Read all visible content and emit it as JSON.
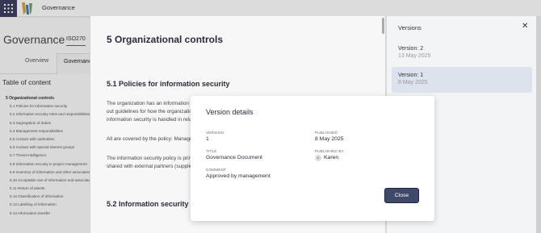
{
  "topbar": {
    "title": "Governance"
  },
  "background": {
    "page_title": "Governance",
    "doc_id": "ISO270",
    "tabs": [
      "Overview",
      "Governance"
    ],
    "toc_title": "Table of content",
    "toc": [
      "5 Organizational controls",
      "5.1 Policies for information security",
      "5.2 Information security roles and responsibilities",
      "5.3 Segregation of duties",
      "5.4 Management responsibilities",
      "5.5 Contact with authorities",
      "5.6 Contact with special interest groups",
      "5.7 Threat intelligence",
      "5.8 Information security in project management",
      "5.9 Inventory of information and other associated",
      "5.10 Acceptable use of information and associated",
      "5.11 Return of assets",
      "5.12 Classification of information",
      "5.13 Labelling of information",
      "5.14 Information transfer"
    ]
  },
  "document": {
    "h1": "5 Organizational controls",
    "h2_1": "5.1 Policies for information security",
    "p1": "The organization has an information security policy which describes the principles for information security work and set out guidelines for how the organization complies with legal requirements (including GDPR) and regulations and how information security is handled in relation to other policy requirements.",
    "p2": "All are covered by the policy: Management, employees, consultants, contractors and temporary staff.",
    "p3": "The information security policy is primarily aimed at internal use, but also covers External Relations, but can also be shared with external partners (suppliers, partners, consultants, etc.), where the collaboration is so extensive.",
    "h2_2": "5.2 Information security roles and responsibilities"
  },
  "versions": {
    "title": "Versions",
    "close_icon": "close-icon",
    "items": [
      {
        "name": "Version: 2",
        "date": "13 May 2025"
      },
      {
        "name": "Version: 1",
        "date": "8 May 2025"
      }
    ]
  },
  "modal": {
    "title": "Version details",
    "version_label": "VERSION",
    "version_value": "1",
    "published_label": "PUBLISHED",
    "published_value": "8 May 2025",
    "title_label": "TITLE",
    "title_value": "Governance Document",
    "published_by_label": "PUBLISHED BY",
    "published_by_initial": "K",
    "published_by_value": "Karen",
    "comment_label": "COMMENT",
    "comment_value": "Approved by management",
    "close_label": "Close"
  },
  "colors": {
    "topbar_button": "#3a3f5c",
    "primary_button": "#3f4a6b",
    "selected_version": "#dde3ec"
  }
}
